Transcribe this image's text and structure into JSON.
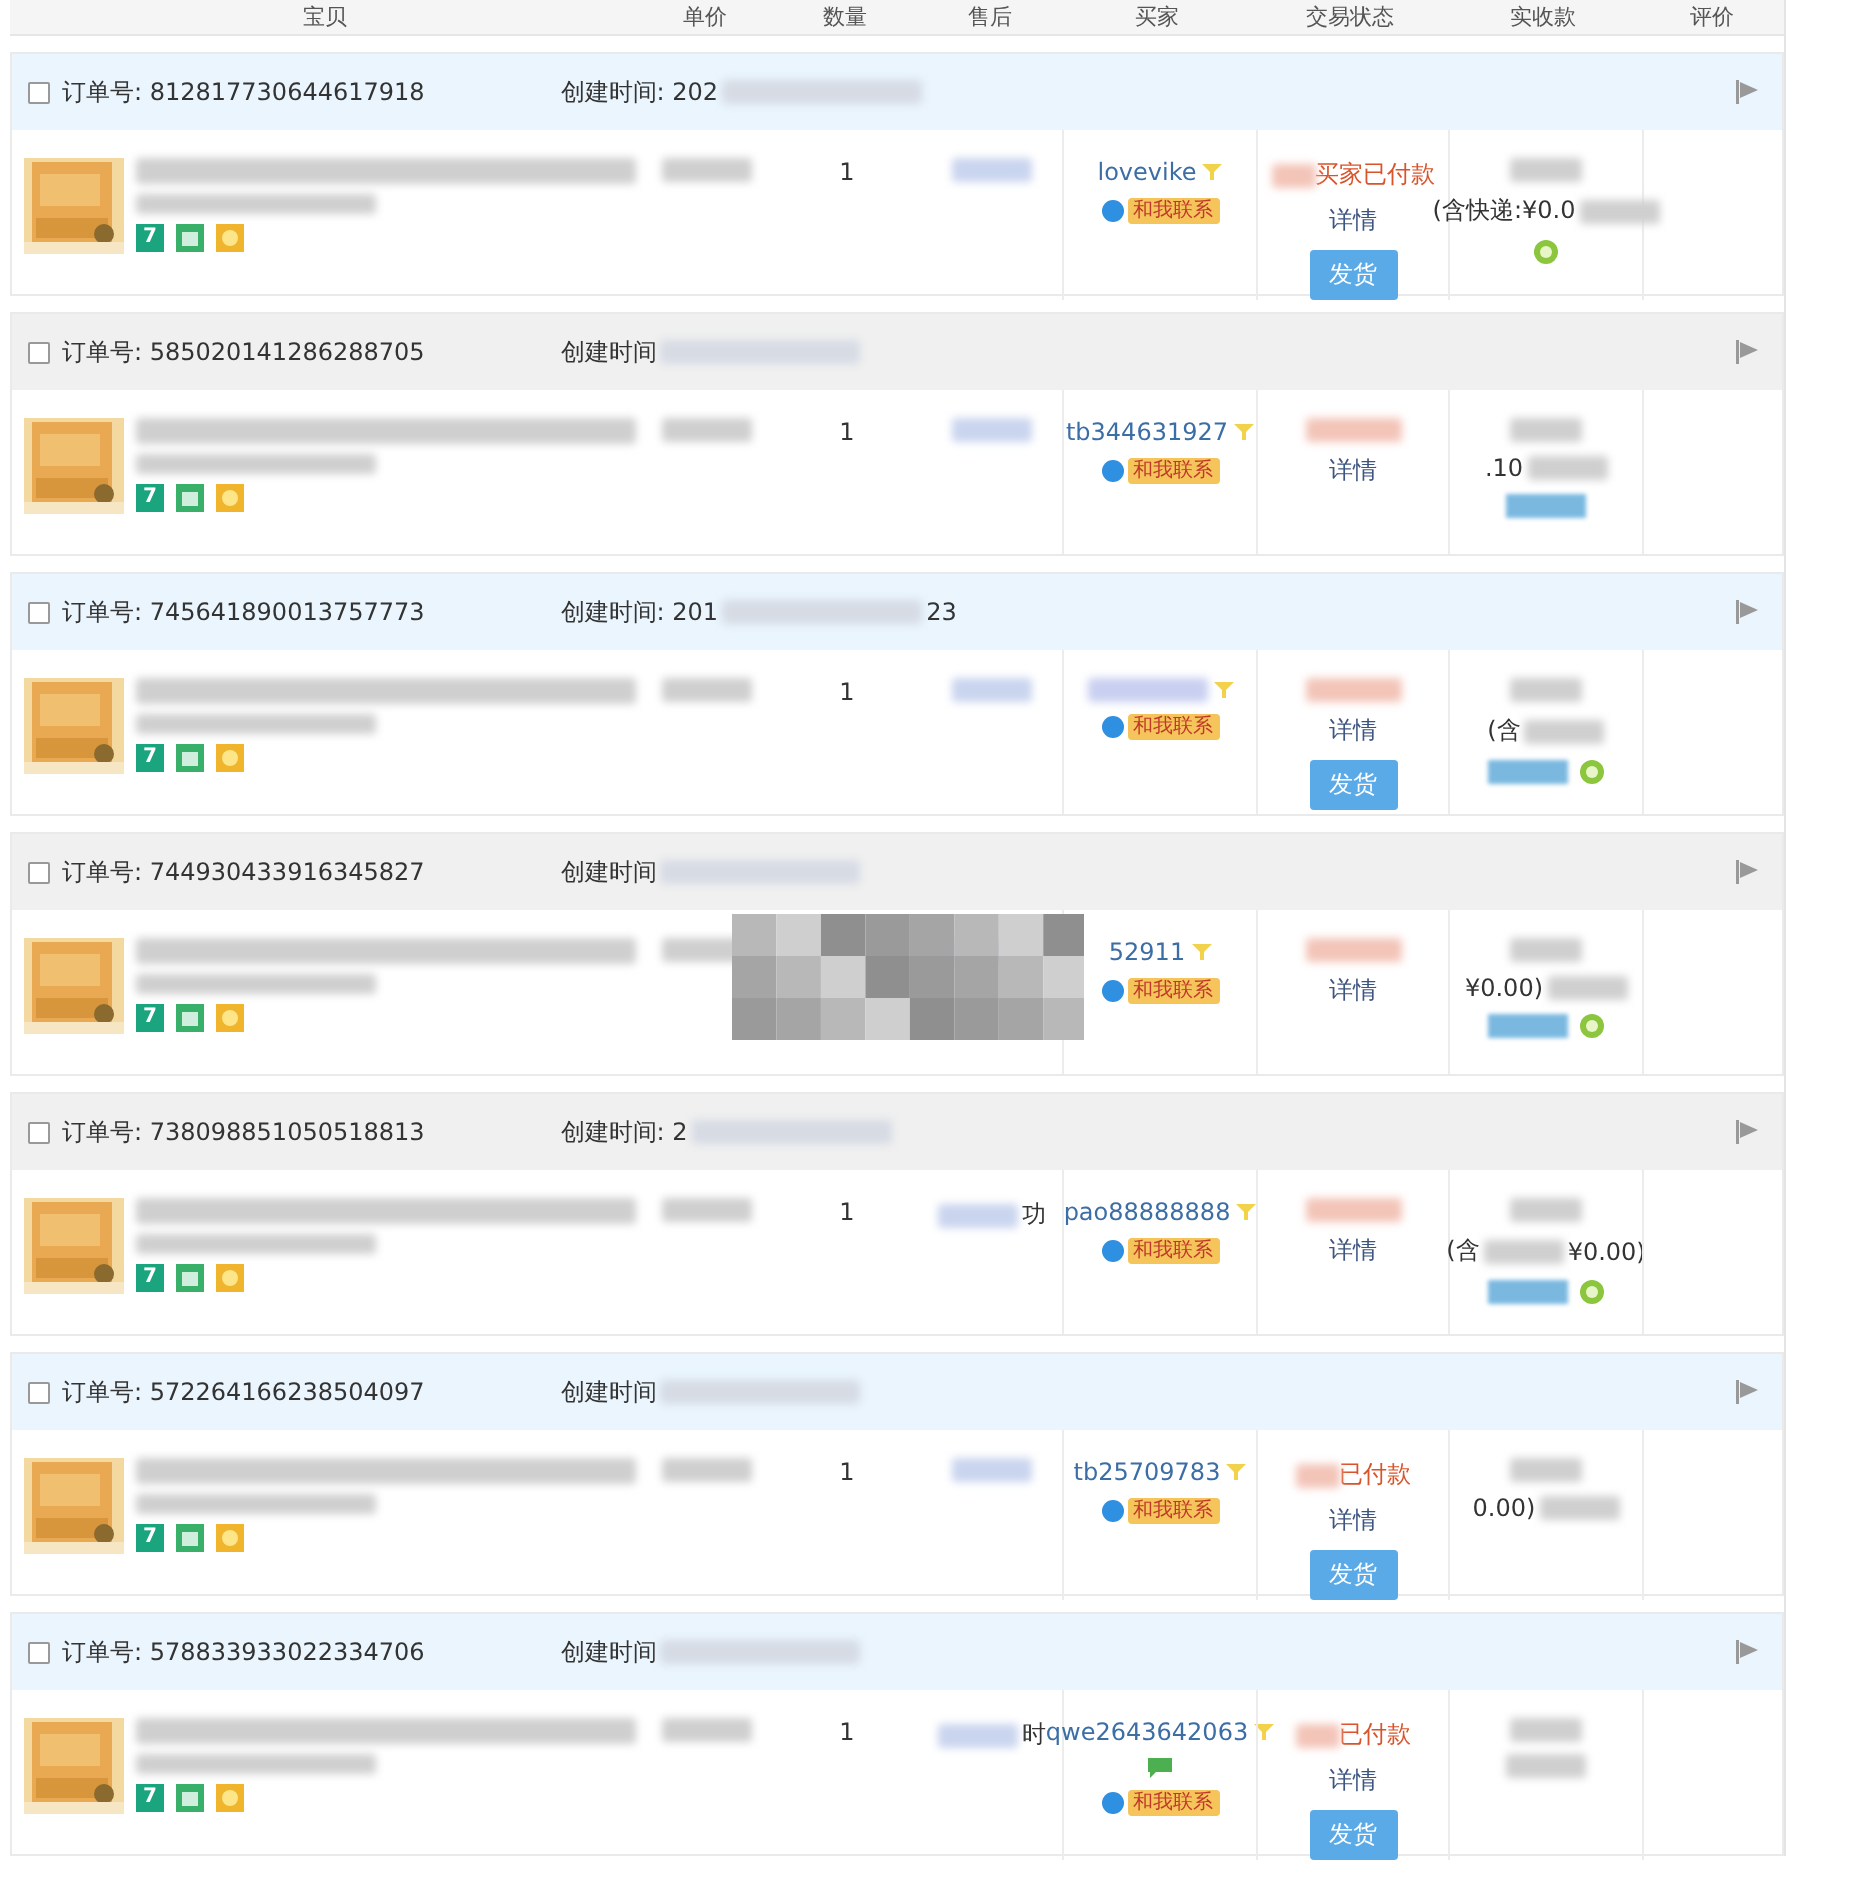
{
  "columns": [
    "宝贝",
    "单价",
    "数量",
    "售后",
    "买家",
    "交易状态",
    "实收款",
    "评价"
  ],
  "orders": [
    {
      "highlighted": true,
      "checked": false,
      "order": "订单号: 812817730644617918",
      "created": "创建时间: 202",
      "badge": "7",
      "quantity": "1",
      "buyer": "lovevike",
      "message": false,
      "contact": "和我联系",
      "status": "买家已付款",
      "detail": "详情",
      "ship": "发货",
      "payment": "(含快递:¥0.0",
      "tag": false,
      "coin": true
    },
    {
      "highlighted": false,
      "checked": false,
      "order": "订单号: 585020141286288705",
      "created": "创建时间",
      "badge": "7",
      "quantity": "1",
      "buyer": "tb344631927",
      "message": false,
      "contact": "和我联系",
      "detail": "详情",
      "payment": ".10",
      "tag": true,
      "coin": false
    },
    {
      "highlighted": true,
      "checked": false,
      "order": "订单号: 745641890013757773",
      "created": "创建时间: 201",
      "created_tail": "23",
      "badge": "7",
      "quantity": "1",
      "message": false,
      "contact": "和我联系",
      "detail": "详情",
      "ship": "发货",
      "payment": "(含",
      "tag": true,
      "coin": true
    },
    {
      "highlighted": false,
      "checked": false,
      "order": "订单号: 744930433916345827",
      "created": "创建时间",
      "badge": "7",
      "mosaic": true,
      "buyer": "52911",
      "message": false,
      "contact": "和我联系",
      "detail": "详情",
      "payment": "¥0.00)",
      "tag": true,
      "coin": true
    },
    {
      "highlighted": false,
      "checked": false,
      "order": "订单号: 738098851050518813",
      "created": "创建时间: 2",
      "badge": "7",
      "quantity": "1",
      "after_sale": "功",
      "buyer": "pao88888888",
      "message": false,
      "contact": "和我联系",
      "detail": "详情",
      "payment": "(含",
      "payment_tail": "¥0.00)",
      "tag": true,
      "coin": true
    },
    {
      "highlighted": true,
      "checked": false,
      "order": "订单号: 572264166238504097",
      "created": "创建时间",
      "badge": "7",
      "quantity": "1",
      "buyer": "tb25709783",
      "message": false,
      "contact": "和我联系",
      "status": "已付款",
      "detail": "详情",
      "ship": "发货",
      "payment": "0.00)",
      "tag": false,
      "coin": false
    },
    {
      "highlighted": true,
      "checked": false,
      "order": "订单号: 578833933022334706",
      "created": "创建时间",
      "badge": "7",
      "quantity": "1",
      "after_sale": "时",
      "buyer": "qwe2643642063",
      "message": true,
      "contact": "和我联系",
      "status": "已付款",
      "detail": "详情",
      "ship": "发货",
      "tag": false,
      "coin": false
    }
  ]
}
